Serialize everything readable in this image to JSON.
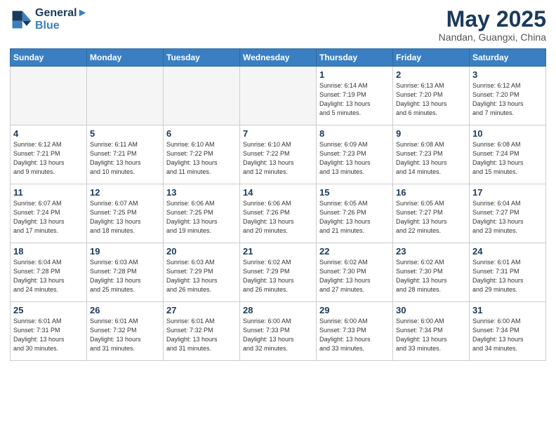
{
  "header": {
    "logo_line1": "General",
    "logo_line2": "Blue",
    "title": "May 2025",
    "location": "Nandan, Guangxi, China"
  },
  "weekdays": [
    "Sunday",
    "Monday",
    "Tuesday",
    "Wednesday",
    "Thursday",
    "Friday",
    "Saturday"
  ],
  "weeks": [
    [
      {
        "day": "",
        "empty": true
      },
      {
        "day": "",
        "empty": true
      },
      {
        "day": "",
        "empty": true
      },
      {
        "day": "",
        "empty": true
      },
      {
        "day": "1",
        "info": "Sunrise: 6:14 AM\nSunset: 7:19 PM\nDaylight: 13 hours\nand 5 minutes."
      },
      {
        "day": "2",
        "info": "Sunrise: 6:13 AM\nSunset: 7:20 PM\nDaylight: 13 hours\nand 6 minutes."
      },
      {
        "day": "3",
        "info": "Sunrise: 6:12 AM\nSunset: 7:20 PM\nDaylight: 13 hours\nand 7 minutes."
      }
    ],
    [
      {
        "day": "4",
        "info": "Sunrise: 6:12 AM\nSunset: 7:21 PM\nDaylight: 13 hours\nand 9 minutes."
      },
      {
        "day": "5",
        "info": "Sunrise: 6:11 AM\nSunset: 7:21 PM\nDaylight: 13 hours\nand 10 minutes."
      },
      {
        "day": "6",
        "info": "Sunrise: 6:10 AM\nSunset: 7:22 PM\nDaylight: 13 hours\nand 11 minutes."
      },
      {
        "day": "7",
        "info": "Sunrise: 6:10 AM\nSunset: 7:22 PM\nDaylight: 13 hours\nand 12 minutes."
      },
      {
        "day": "8",
        "info": "Sunrise: 6:09 AM\nSunset: 7:23 PM\nDaylight: 13 hours\nand 13 minutes."
      },
      {
        "day": "9",
        "info": "Sunrise: 6:08 AM\nSunset: 7:23 PM\nDaylight: 13 hours\nand 14 minutes."
      },
      {
        "day": "10",
        "info": "Sunrise: 6:08 AM\nSunset: 7:24 PM\nDaylight: 13 hours\nand 15 minutes."
      }
    ],
    [
      {
        "day": "11",
        "info": "Sunrise: 6:07 AM\nSunset: 7:24 PM\nDaylight: 13 hours\nand 17 minutes."
      },
      {
        "day": "12",
        "info": "Sunrise: 6:07 AM\nSunset: 7:25 PM\nDaylight: 13 hours\nand 18 minutes."
      },
      {
        "day": "13",
        "info": "Sunrise: 6:06 AM\nSunset: 7:25 PM\nDaylight: 13 hours\nand 19 minutes."
      },
      {
        "day": "14",
        "info": "Sunrise: 6:06 AM\nSunset: 7:26 PM\nDaylight: 13 hours\nand 20 minutes."
      },
      {
        "day": "15",
        "info": "Sunrise: 6:05 AM\nSunset: 7:26 PM\nDaylight: 13 hours\nand 21 minutes."
      },
      {
        "day": "16",
        "info": "Sunrise: 6:05 AM\nSunset: 7:27 PM\nDaylight: 13 hours\nand 22 minutes."
      },
      {
        "day": "17",
        "info": "Sunrise: 6:04 AM\nSunset: 7:27 PM\nDaylight: 13 hours\nand 23 minutes."
      }
    ],
    [
      {
        "day": "18",
        "info": "Sunrise: 6:04 AM\nSunset: 7:28 PM\nDaylight: 13 hours\nand 24 minutes."
      },
      {
        "day": "19",
        "info": "Sunrise: 6:03 AM\nSunset: 7:28 PM\nDaylight: 13 hours\nand 25 minutes."
      },
      {
        "day": "20",
        "info": "Sunrise: 6:03 AM\nSunset: 7:29 PM\nDaylight: 13 hours\nand 26 minutes."
      },
      {
        "day": "21",
        "info": "Sunrise: 6:02 AM\nSunset: 7:29 PM\nDaylight: 13 hours\nand 26 minutes."
      },
      {
        "day": "22",
        "info": "Sunrise: 6:02 AM\nSunset: 7:30 PM\nDaylight: 13 hours\nand 27 minutes."
      },
      {
        "day": "23",
        "info": "Sunrise: 6:02 AM\nSunset: 7:30 PM\nDaylight: 13 hours\nand 28 minutes."
      },
      {
        "day": "24",
        "info": "Sunrise: 6:01 AM\nSunset: 7:31 PM\nDaylight: 13 hours\nand 29 minutes."
      }
    ],
    [
      {
        "day": "25",
        "info": "Sunrise: 6:01 AM\nSunset: 7:31 PM\nDaylight: 13 hours\nand 30 minutes."
      },
      {
        "day": "26",
        "info": "Sunrise: 6:01 AM\nSunset: 7:32 PM\nDaylight: 13 hours\nand 31 minutes."
      },
      {
        "day": "27",
        "info": "Sunrise: 6:01 AM\nSunset: 7:32 PM\nDaylight: 13 hours\nand 31 minutes."
      },
      {
        "day": "28",
        "info": "Sunrise: 6:00 AM\nSunset: 7:33 PM\nDaylight: 13 hours\nand 32 minutes."
      },
      {
        "day": "29",
        "info": "Sunrise: 6:00 AM\nSunset: 7:33 PM\nDaylight: 13 hours\nand 33 minutes."
      },
      {
        "day": "30",
        "info": "Sunrise: 6:00 AM\nSunset: 7:34 PM\nDaylight: 13 hours\nand 33 minutes."
      },
      {
        "day": "31",
        "info": "Sunrise: 6:00 AM\nSunset: 7:34 PM\nDaylight: 13 hours\nand 34 minutes."
      }
    ]
  ]
}
